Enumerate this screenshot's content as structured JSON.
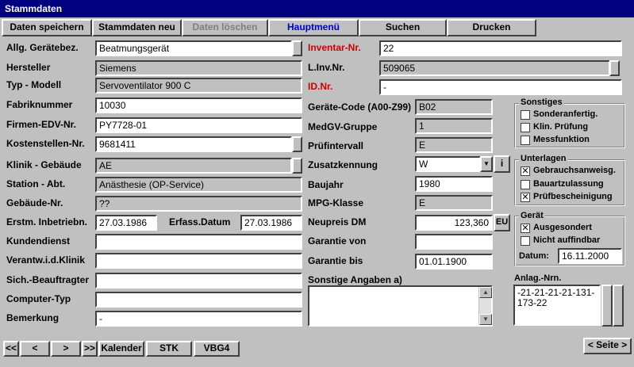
{
  "window": {
    "title": "Stammdaten"
  },
  "tabs": [
    {
      "label": "Daten speichern"
    },
    {
      "label": "Stammdaten neu"
    },
    {
      "label": "Daten löschen"
    },
    {
      "label": "Hauptmenü"
    },
    {
      "label": "Suchen"
    },
    {
      "label": "Drucken"
    }
  ],
  "left": {
    "geraetebez": {
      "label": "Allg. Gerätebez.",
      "value": "Beatmungsgerät"
    },
    "hersteller": {
      "label": "Hersteller",
      "value": "Siemens"
    },
    "typ": {
      "label": "Typ - Modell",
      "value": "Servoventilator 900 C"
    },
    "fabriknr": {
      "label": "Fabriknummer",
      "value": "10030"
    },
    "firmenedv": {
      "label": "Firmen-EDV-Nr.",
      "value": "PY7728-01"
    },
    "kostenstelle": {
      "label": "Kostenstellen-Nr.",
      "value": "9681411"
    },
    "klinik": {
      "label": "Klinik - Gebäude",
      "value": "AE"
    },
    "station": {
      "label": "Station - Abt.",
      "value": "Anästhesie (OP-Service)"
    },
    "gebaeude": {
      "label": "Gebäude-Nr.",
      "value": "??"
    },
    "inbetrieb": {
      "label": "Erstm. Inbetriebn.",
      "value": "27.03.1986"
    },
    "erfass": {
      "label": "Erfass.Datum",
      "value": "27.03.1986"
    },
    "kundendienst": {
      "label": "Kundendienst",
      "value": ""
    },
    "verantw": {
      "label": "Verantw.i.d.Klinik",
      "value": ""
    },
    "sich": {
      "label": "Sich.-Beauftragter",
      "value": ""
    },
    "computer": {
      "label": "Computer-Typ",
      "value": ""
    },
    "bemerkung": {
      "label": "Bemerkung",
      "value": "-"
    }
  },
  "right": {
    "inventar": {
      "label": "Inventar-Nr.",
      "value": "22"
    },
    "linv": {
      "label": "L.Inv.Nr.",
      "value": "509065"
    },
    "idnr": {
      "label": "ID.Nr.",
      "value": "-"
    },
    "geraetecode": {
      "label": "Geräte-Code (A00-Z99)",
      "value": "B02"
    },
    "medgv": {
      "label": "MedGV-Gruppe",
      "value": "1"
    },
    "pruef": {
      "label": "Prüfintervall",
      "value": "E"
    },
    "zusatz": {
      "label": "Zusatzkennung",
      "value": "W",
      "info": "i"
    },
    "baujahr": {
      "label": "Baujahr",
      "value": "1980"
    },
    "mpg": {
      "label": "MPG-Klasse",
      "value": "E"
    },
    "neupreis": {
      "label": "Neupreis DM",
      "value": "123,360",
      "currency": "EU"
    },
    "garantie_von": {
      "label": "Garantie von",
      "value": ""
    },
    "garantie_bis": {
      "label": "Garantie bis",
      "value": "01.01.1900"
    },
    "sonstige": {
      "label": "Sonstige Angaben a)",
      "value": ""
    }
  },
  "sonstiges": {
    "title": "Sonstiges",
    "items": [
      {
        "label": "Sonderanfertig.",
        "checked": ""
      },
      {
        "label": "Klin. Prüfung",
        "checked": ""
      },
      {
        "label": "Messfunktion",
        "checked": ""
      }
    ]
  },
  "unterlagen": {
    "title": "Unterlagen",
    "items": [
      {
        "label": "Gebrauchsanweisg.",
        "checked": "✕"
      },
      {
        "label": "Bauartzulassung",
        "checked": ""
      },
      {
        "label": "Prüfbescheinigung",
        "checked": "✕"
      }
    ]
  },
  "geraet": {
    "title": "Gerät",
    "items": [
      {
        "label": "Ausgesondert",
        "checked": "✕"
      },
      {
        "label": "Nicht auffindbar",
        "checked": ""
      }
    ],
    "datum_label": "Datum:",
    "datum": "16.11.2000"
  },
  "anlag": {
    "label": "Anlag.-Nrn.",
    "value": "-21-21-21-21-131-173-22"
  },
  "nav": {
    "first": "<<",
    "prev": "<",
    "next": ">",
    "last": ">>",
    "kalender": "Kalender",
    "stk": "STK",
    "vbg4": "VBG4",
    "seite": "< Seite >"
  },
  "colors": {
    "title_bg": "#000080",
    "face": "#c0c0c0",
    "required_red": "#cc0000",
    "menu_blue": "#0000cc"
  }
}
